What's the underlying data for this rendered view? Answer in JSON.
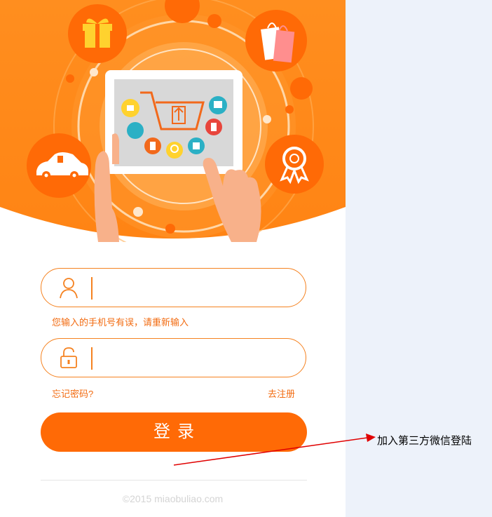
{
  "form": {
    "username": {
      "icon": "user-icon",
      "value": "",
      "placeholder": ""
    },
    "error_message": "您输入的手机号有误，请重新输入",
    "password": {
      "icon": "unlock-icon",
      "value": "",
      "placeholder": ""
    },
    "forgot_password": "忘记密码?",
    "register": "去注册",
    "login_button": "登录"
  },
  "footer": {
    "copyright": "©2015 miaobuliao.com"
  },
  "annotation": {
    "text": "加入第三方微信登陆"
  },
  "hero": {
    "icons": [
      "gift-icon",
      "shopping-bag-icon",
      "car-icon",
      "award-ribbon-icon",
      "tablet-icon",
      "shopping-cart-icon",
      "hand-icon"
    ]
  },
  "colors": {
    "brand_orange": "#ff6a06",
    "hero_orange": "#ff8a1e",
    "accent_line": "#f58220",
    "annotation_arrow": "#e00000",
    "side_panel": "#edf2fa"
  }
}
